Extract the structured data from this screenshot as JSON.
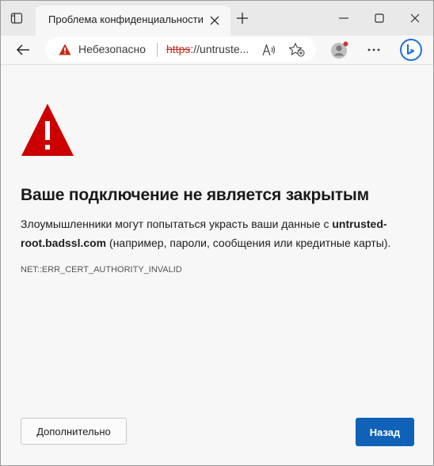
{
  "tab": {
    "title": "Проблема конфиденциальности"
  },
  "addressbar": {
    "security_label": "Небезопасно",
    "url_scheme": "https",
    "url_rest": "://untruste..."
  },
  "page": {
    "heading": "Ваше подключение не является закрытым",
    "desc_before": "Злоумышленники могут попытаться украсть ваши данные с ",
    "desc_host": "untrusted-root.badssl.com",
    "desc_after": " (например, пароли, сообщения или кредитные карты).",
    "error_code": "NET::ERR_CERT_AUTHORITY_INVALID",
    "advanced_label": "Дополнительно",
    "back_label": "Назад"
  },
  "icons": {
    "tab_actions": "tab-actions-icon",
    "tab_close": "close-icon",
    "new_tab": "plus-icon",
    "minimize": "minimize-icon",
    "maximize": "maximize-icon",
    "close": "close-icon",
    "back": "back-arrow-icon",
    "warning": "warning-triangle-icon",
    "read_aloud": "read-aloud-icon",
    "favorites": "add-favorite-icon",
    "profile": "profile-avatar-icon",
    "more": "more-dots-icon",
    "copilot": "bing-copilot-icon"
  },
  "colors": {
    "warning_red": "#cc0000",
    "scheme_red": "#c42b1c",
    "primary_button": "#0f62b8",
    "profile_dot": "#d13438"
  }
}
